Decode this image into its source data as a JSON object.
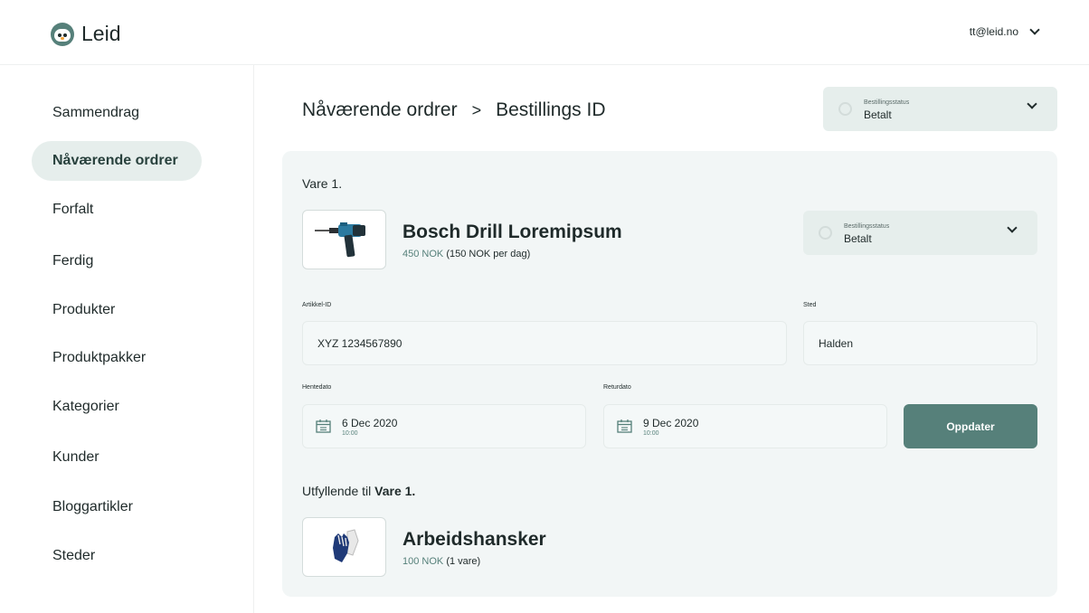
{
  "header": {
    "logo_text": "Leid",
    "user_email": "tt@leid.no"
  },
  "sidebar": {
    "items": [
      {
        "label": "Sammendrag"
      },
      {
        "label": "Nåværende ordrer"
      },
      {
        "label": "Forfalt"
      },
      {
        "label": "Ferdig"
      },
      {
        "label": "Produkter"
      },
      {
        "label": "Produktpakker"
      },
      {
        "label": "Kategorier"
      },
      {
        "label": "Kunder"
      },
      {
        "label": "Bloggartikler"
      },
      {
        "label": "Steder"
      }
    ],
    "active_index": 1
  },
  "breadcrumb": {
    "parent": "Nåværende ordrer",
    "separator": ">",
    "current": "Bestillings ID"
  },
  "order_status": {
    "label": "Bestillingsstatus",
    "value": "Betalt"
  },
  "item": {
    "heading": "Vare 1.",
    "title": "Bosch Drill Loremipsum",
    "price": "450 NOK",
    "price_detail": "(150 NOK per dag)",
    "status": {
      "label": "Bestillingsstatus",
      "value": "Betalt"
    },
    "article_id_label": "Artikkel-ID",
    "article_id": "XYZ 1234567890",
    "location_label": "Sted",
    "location": "Halden",
    "pickup_label": "Hentedato",
    "pickup_date": "6 Dec 2020",
    "pickup_time": "10:00",
    "return_label": "Returdato",
    "return_date": "9 Dec 2020",
    "return_time": "10:00",
    "update_button": "Oppdater"
  },
  "supplement": {
    "prefix": "Utfyllende til",
    "ref": "Vare 1.",
    "title": "Arbeidshansker",
    "price": "100 NOK",
    "price_detail": "(1 vare)"
  },
  "colors": {
    "accent": "#56807a",
    "panel": "#f2f6f6",
    "select_bg": "#e6eeec"
  }
}
